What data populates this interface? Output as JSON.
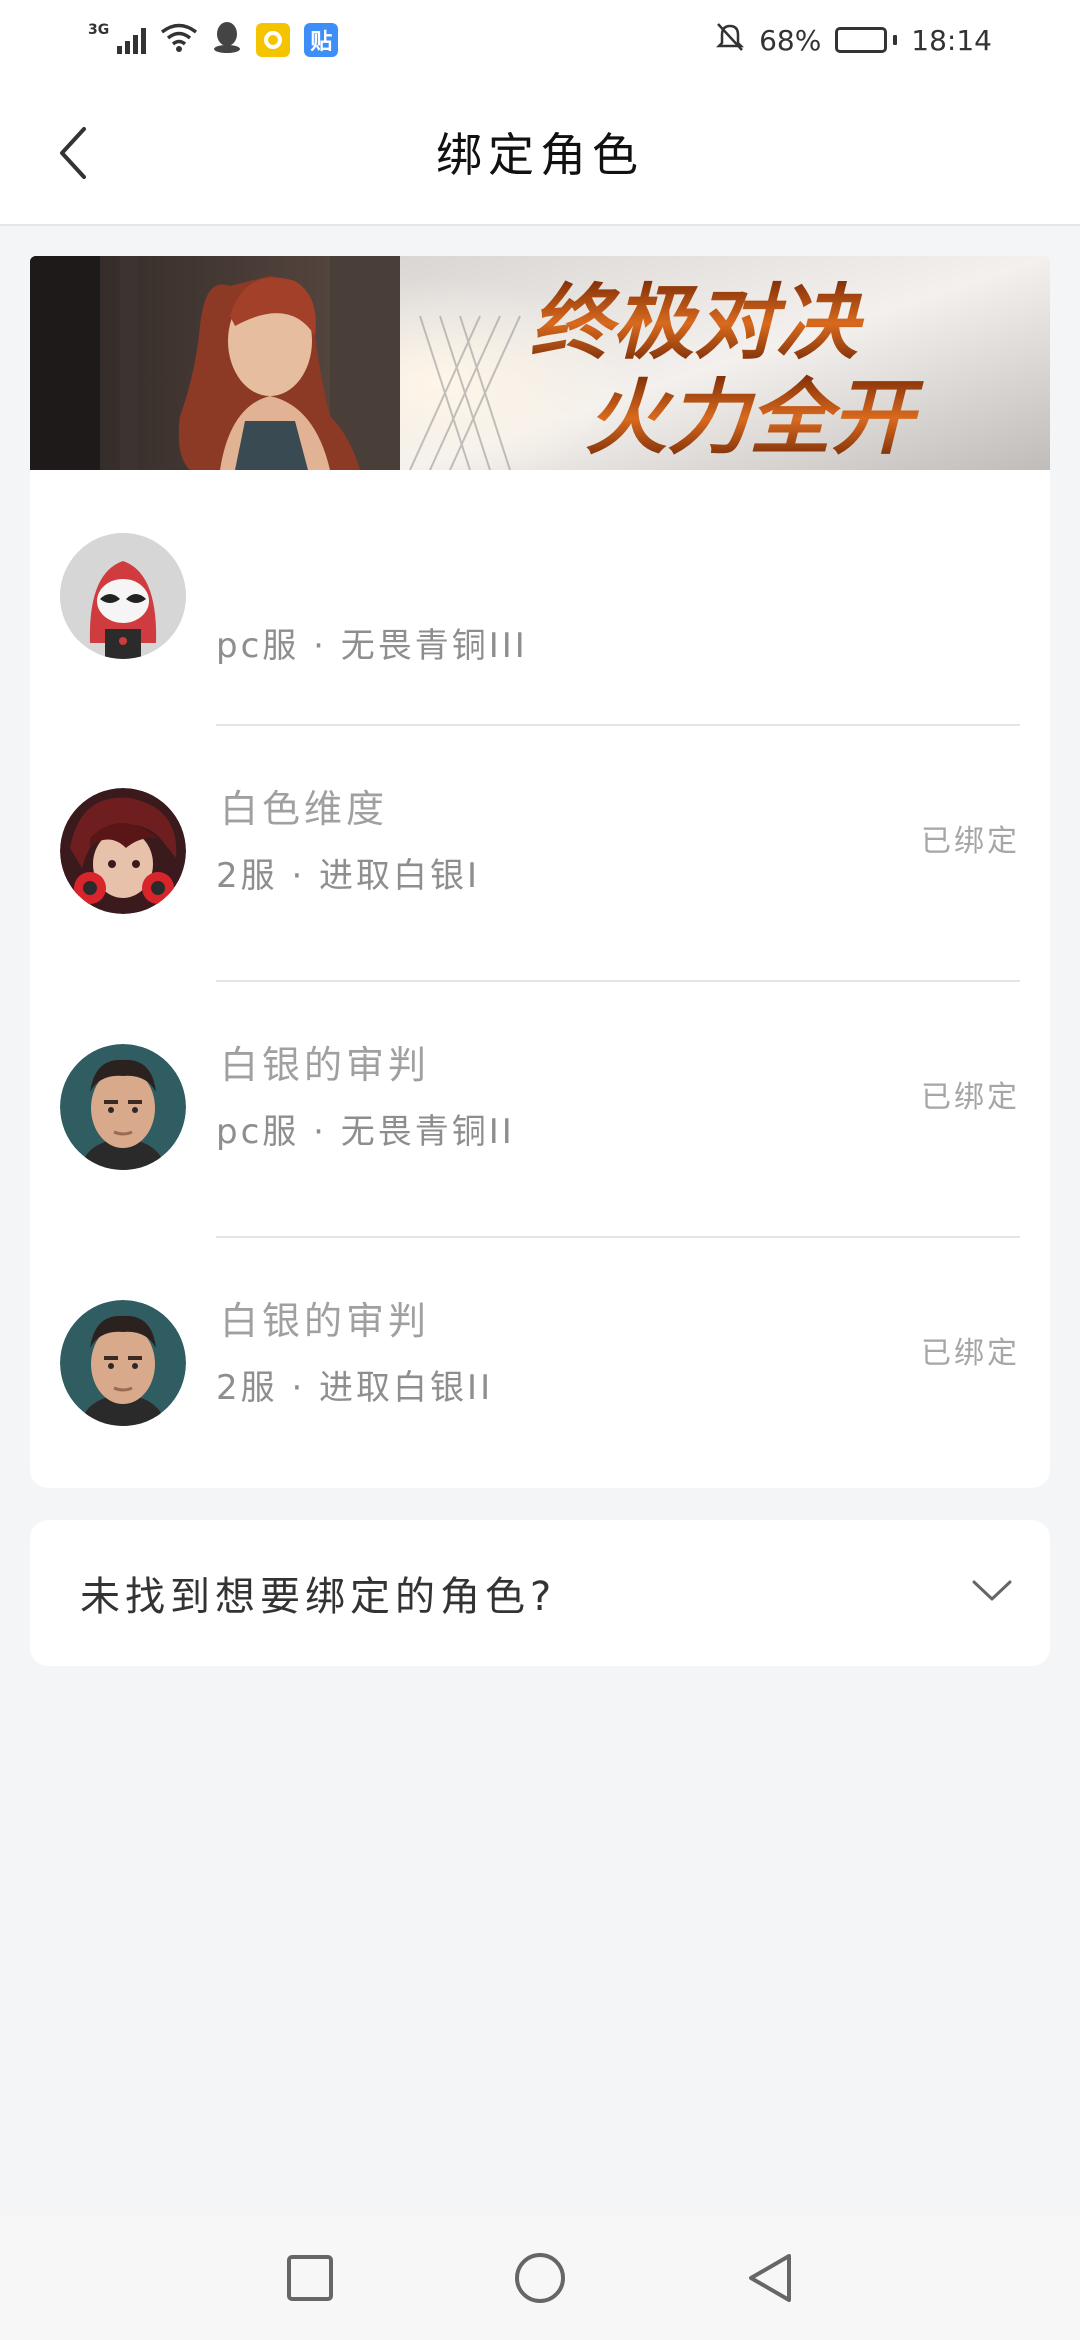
{
  "status_bar": {
    "network": "3G",
    "badge_text": "贴",
    "battery": "68%",
    "battery_level": 0.68,
    "time": "18:14"
  },
  "header": {
    "title": "绑定角色"
  },
  "banner": {
    "line1": "终极对决",
    "line2": "火力全开"
  },
  "roles": [
    {
      "name": "",
      "meta": "pc服 · 无畏青铜III",
      "status": "",
      "avatar": "hooded-character-avatar"
    },
    {
      "name": "白色维度",
      "meta": "2服 · 进取白银I",
      "status": "已绑定",
      "avatar": "red-hair-character-avatar"
    },
    {
      "name": "白银的审判",
      "meta": "pc服 · 无畏青铜II",
      "status": "已绑定",
      "avatar": "soldier-character-avatar"
    },
    {
      "name": "白银的审判",
      "meta": "2服 · 进取白银II",
      "status": "已绑定",
      "avatar": "soldier-character-avatar"
    }
  ],
  "not_found": {
    "label": "未找到想要绑定的角色?"
  },
  "colors": {
    "background": "#f4f5f7",
    "card": "#ffffff",
    "muted_text": "#a0a0a0",
    "banner_text": "#c9581a"
  }
}
